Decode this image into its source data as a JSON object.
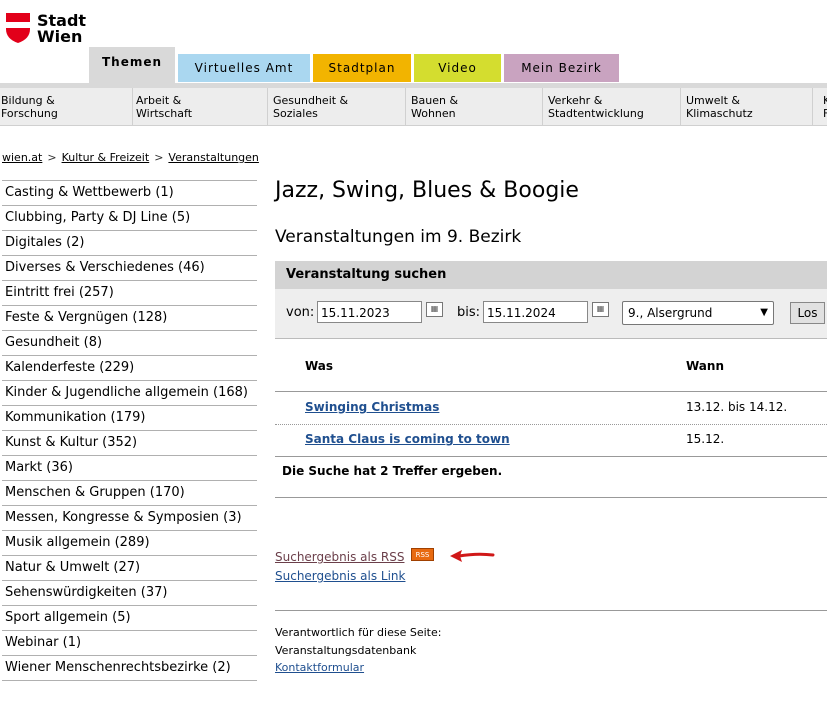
{
  "logo": {
    "line1": "Stadt",
    "line2": "Wien",
    "color": "#e2001a"
  },
  "tabs": [
    {
      "label": "Themen",
      "color": "#d9d9d9"
    },
    {
      "label": "Virtuelles Amt",
      "color": "#aad7f0"
    },
    {
      "label": "Stadtplan",
      "color": "#f2b400"
    },
    {
      "label": "Video",
      "color": "#d4dd2f"
    },
    {
      "label": "Mein Bezirk",
      "color": "#c9a3c0"
    }
  ],
  "topnav": [
    {
      "line1": "Bildung &",
      "line2": "Forschung"
    },
    {
      "line1": "Arbeit &",
      "line2": "Wirtschaft"
    },
    {
      "line1": "Gesundheit &",
      "line2": "Soziales"
    },
    {
      "line1": "Bauen &",
      "line2": "Wohnen"
    },
    {
      "line1": "Verkehr &",
      "line2": "Stadtentwicklung"
    },
    {
      "line1": "Umwelt &",
      "line2": "Klimaschutz"
    },
    {
      "line1": "K",
      "line2": "F"
    }
  ],
  "breadcrumb": [
    "wien.at",
    "Kultur & Freizeit",
    "Veranstaltungen"
  ],
  "sidebar": [
    "Casting & Wettbewerb (1)",
    "Clubbing, Party & DJ Line (5)",
    "Digitales (2)",
    "Diverses & Verschiedenes (46)",
    "Eintritt frei (257)",
    "Feste & Vergnügen (128)",
    "Gesundheit (8)",
    "Kalenderfeste (229)",
    "Kinder & Jugendliche allgemein (168)",
    "Kommunikation (179)",
    "Kunst & Kultur (352)",
    "Markt (36)",
    "Menschen & Gruppen (170)",
    "Messen, Kongresse & Symposien (3)",
    "Musik allgemein (289)",
    "Natur & Umwelt (27)",
    "Sehenswürdigkeiten (37)",
    "Sport allgemein (5)",
    "Webinar (1)",
    "Wiener Menschenrechtsbezirke (2)"
  ],
  "main": {
    "title": "Jazz, Swing, Blues & Boogie",
    "subtitle": "Veranstaltungen im 9. Bezirk",
    "search": {
      "heading": "Veranstaltung suchen",
      "from_label": "von:",
      "from_value": "15.11.2023",
      "to_label": "bis:",
      "to_value": "15.11.2024",
      "district": "9., Alsergrund",
      "submit": "Los"
    },
    "results": {
      "col_what": "Was",
      "col_when": "Wann",
      "rows": [
        {
          "title": "Swinging Christmas",
          "date": "13.12. bis 14.12."
        },
        {
          "title": "Santa Claus is coming to town",
          "date": "15.12."
        }
      ],
      "summary": "Die Suche hat 2 Treffer ergeben."
    },
    "rss_link": "Suchergebnis als RSS",
    "rss_badge": "RSS",
    "link_link": "Suchergebnis als Link",
    "footer": {
      "responsible": "Verantwortlich für diese Seite:",
      "dept": "Veranstaltungsdatenbank",
      "contact": "Kontaktformular"
    }
  }
}
